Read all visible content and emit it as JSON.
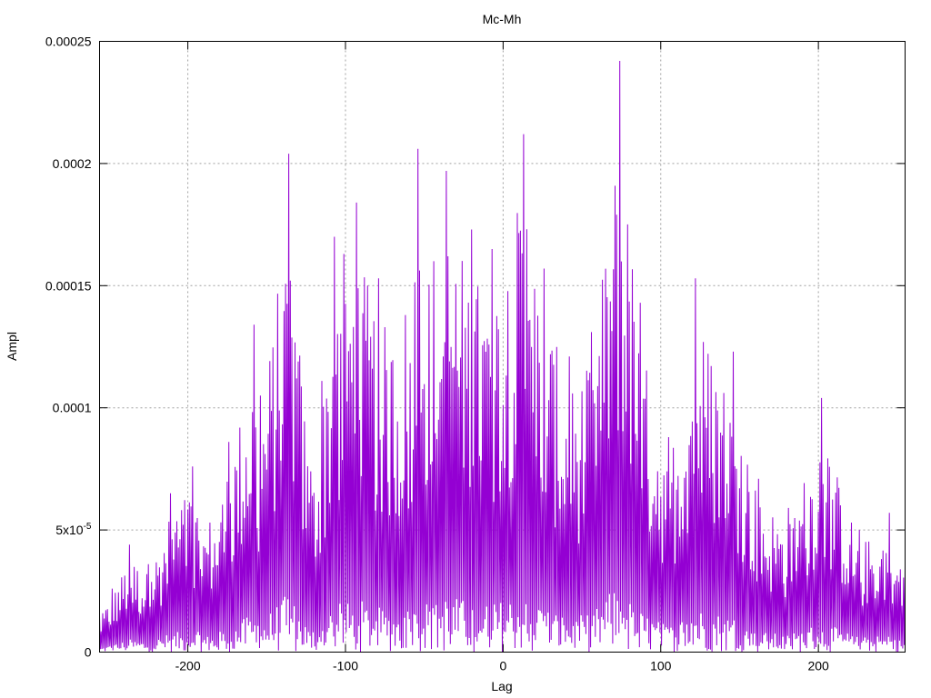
{
  "chart_data": {
    "type": "line",
    "title": "Mc-Mh",
    "xlabel": "Lag",
    "ylabel": "Ampl",
    "xlim": [
      -256,
      255
    ],
    "ylim": [
      0,
      0.00025
    ],
    "x_ticks": [
      {
        "value": -200,
        "label": "-200"
      },
      {
        "value": -100,
        "label": "-100"
      },
      {
        "value": 0,
        "label": "0"
      },
      {
        "value": 100,
        "label": "100"
      },
      {
        "value": 200,
        "label": "200"
      }
    ],
    "y_ticks": [
      {
        "value": 0,
        "label": "0",
        "sup": ""
      },
      {
        "value": 5e-05,
        "label": "5x10",
        "sup": "-5"
      },
      {
        "value": 0.0001,
        "label": "0.0001",
        "sup": ""
      },
      {
        "value": 0.00015,
        "label": "0.00015",
        "sup": ""
      },
      {
        "value": 0.0002,
        "label": "0.0002",
        "sup": ""
      },
      {
        "value": 0.00025,
        "label": "0.00025",
        "sup": ""
      }
    ],
    "grid": true,
    "colors": {
      "series": "#9400d3",
      "grid": "#a0a0a0",
      "frame": "#000000"
    },
    "peaks": [
      {
        "x": -256,
        "y": 1.5e-05
      },
      {
        "x": -248,
        "y": 2.6e-05
      },
      {
        "x": -237,
        "y": 4.4e-05
      },
      {
        "x": -225,
        "y": 3.6e-05
      },
      {
        "x": -211,
        "y": 6.5e-05
      },
      {
        "x": -197,
        "y": 7.6e-05
      },
      {
        "x": -186,
        "y": 5.3e-05
      },
      {
        "x": -174,
        "y": 8.6e-05
      },
      {
        "x": -158,
        "y": 0.000134
      },
      {
        "x": -154,
        "y": 0.000105
      },
      {
        "x": -136,
        "y": 0.000204
      },
      {
        "x": -122,
        "y": 7.4e-05
      },
      {
        "x": -115,
        "y": 0.000111
      },
      {
        "x": -107,
        "y": 0.00017
      },
      {
        "x": -101,
        "y": 0.000163
      },
      {
        "x": -93,
        "y": 0.000184
      },
      {
        "x": -79,
        "y": 0.000153
      },
      {
        "x": -62,
        "y": 0.000138
      },
      {
        "x": -54,
        "y": 0.000206
      },
      {
        "x": -44,
        "y": 0.00016
      },
      {
        "x": -36,
        "y": 0.000197
      },
      {
        "x": -20,
        "y": 0.000173
      },
      {
        "x": -7,
        "y": 0.000165
      },
      {
        "x": 13,
        "y": 0.000212
      },
      {
        "x": 26,
        "y": 0.000157
      },
      {
        "x": 42,
        "y": 0.000121
      },
      {
        "x": 56,
        "y": 0.000131
      },
      {
        "x": 74,
        "y": 0.000242
      },
      {
        "x": 87,
        "y": 0.000143
      },
      {
        "x": 105,
        "y": 8.8e-05
      },
      {
        "x": 122,
        "y": 0.000153
      },
      {
        "x": 146,
        "y": 0.000123
      },
      {
        "x": 162,
        "y": 7.1e-05
      },
      {
        "x": 181,
        "y": 5.9e-05
      },
      {
        "x": 202,
        "y": 0.000104
      },
      {
        "x": 226,
        "y": 5e-05
      },
      {
        "x": 245,
        "y": 5.7e-05
      },
      {
        "x": 255,
        "y": 3.5e-05
      }
    ]
  }
}
